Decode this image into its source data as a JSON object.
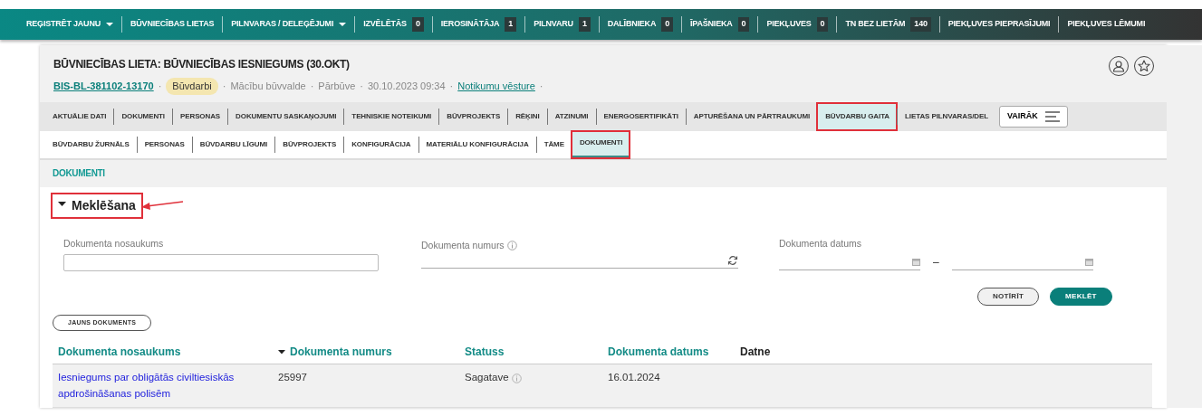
{
  "top_nav": [
    {
      "label": "REĢISTRĒT JAUNU",
      "kind": "dropdown"
    },
    {
      "label": "BŪVNIECĪBAS LIETAS",
      "kind": "link"
    },
    {
      "label": "PILNVARAS / DELEĢĒJUMI",
      "kind": "dropdown"
    },
    {
      "label": "IZVĒLĒTĀS",
      "kind": "counter",
      "count": "0"
    },
    {
      "label": "IEROSINĀTĀJA",
      "kind": "counter",
      "count": "1"
    },
    {
      "label": "PILNVARU",
      "kind": "counter",
      "count": "1"
    },
    {
      "label": "DALĪBNIEKA",
      "kind": "counter",
      "count": "0"
    },
    {
      "label": "ĪPAŠNIEKA",
      "kind": "counter",
      "count": "0"
    },
    {
      "label": "PIEKĻUVES",
      "kind": "counter",
      "count": "0"
    },
    {
      "label": "TN BEZ LIETĀM",
      "kind": "counter",
      "count": "140"
    },
    {
      "label": "PIEKĻUVES PIEPRASĪJUMI",
      "kind": "link"
    },
    {
      "label": "PIEKĻUVES LĒMUMI",
      "kind": "link"
    }
  ],
  "case": {
    "title": "BŪVNIECĪBAS LIETA: BŪVNIECĪBAS IESNIEGUMS (30.OKT)",
    "id_link": "BIS-BL-381102-13170",
    "badge": "Būvdarbi",
    "meta": [
      "Mācību būvvalde",
      "Pārbūve",
      "30.10.2023 09:34"
    ],
    "history_link": "Notikumu vēsture",
    "separator": "·"
  },
  "tabs": [
    {
      "label": "AKTUĀLIE DATI",
      "selected": false,
      "highlighted": false
    },
    {
      "label": "DOKUMENTI",
      "selected": false,
      "highlighted": false
    },
    {
      "label": "PERSONAS",
      "selected": false,
      "highlighted": false
    },
    {
      "label": "DOKUMENTU SASKAŅOJUMI",
      "selected": false,
      "highlighted": false
    },
    {
      "label": "TEHNISKIE NOTEIKUMI",
      "selected": false,
      "highlighted": false
    },
    {
      "label": "BŪVPROJEKTS",
      "selected": false,
      "highlighted": false
    },
    {
      "label": "RĒĶINI",
      "selected": false,
      "highlighted": false
    },
    {
      "label": "ATZINUMI",
      "selected": false,
      "highlighted": false
    },
    {
      "label": "ENERGOSERTIFIKĀTI",
      "selected": false,
      "highlighted": false
    },
    {
      "label": "APTURĒŠANA UN PĀRTRAUKUMI",
      "selected": false,
      "highlighted": false
    },
    {
      "label": "BŪVDARBU GAITA",
      "selected": true,
      "highlighted": true
    },
    {
      "label": "LIETAS PILNVARAS/DEL",
      "selected": false,
      "highlighted": false
    }
  ],
  "more_button": "VAIRĀK",
  "subtabs": [
    {
      "label": "BŪVDARBU ŽURNĀLS",
      "selected": false,
      "highlighted": false
    },
    {
      "label": "PERSONAS",
      "selected": false,
      "highlighted": false
    },
    {
      "label": "BŪVDARBU LĪGUMI",
      "selected": false,
      "highlighted": false
    },
    {
      "label": "BŪVPROJEKTS",
      "selected": false,
      "highlighted": false
    },
    {
      "label": "KONFIGURĀCIJA",
      "selected": false,
      "highlighted": false
    },
    {
      "label": "MATERIĀLU KONFIGURĀCIJA",
      "selected": false,
      "highlighted": false
    },
    {
      "label": "TĀME",
      "selected": false,
      "highlighted": false
    },
    {
      "label": "DOKUMENTI",
      "selected": true,
      "highlighted": true
    }
  ],
  "section_title": "DOKUMENTI",
  "search": {
    "title": "Meklēšana",
    "expanded": true,
    "highlighted": true,
    "name_label": "Dokumenta nosaukums",
    "number_label": "Dokumenta numurs",
    "date_label": "Dokumenta datums",
    "date_separator": "–",
    "clear_button": "NOTĪRĪT",
    "search_button": "MEKLĒT"
  },
  "new_document_button": "JAUNS DOKUMENTS",
  "table": {
    "columns": [
      {
        "label": "Dokumenta nosaukums",
        "sortable": true,
        "sorted": false
      },
      {
        "label": "Dokumenta numurs",
        "sortable": true,
        "sorted": true
      },
      {
        "label": "Statuss",
        "sortable": true,
        "sorted": false
      },
      {
        "label": "Dokumenta datums",
        "sortable": true,
        "sorted": false
      },
      {
        "label": "Datne",
        "sortable": false,
        "sorted": false
      }
    ],
    "rows": [
      {
        "name": "Iesniegums par obligātās civiltiesiskās apdrošināšanas polisēm",
        "number": "25997",
        "status": "Sagatave",
        "date": "16.01.2024"
      }
    ]
  }
}
